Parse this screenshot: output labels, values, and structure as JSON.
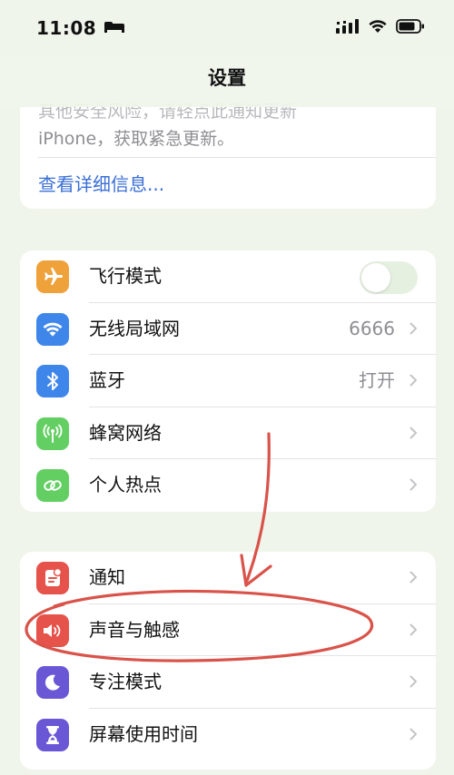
{
  "status_bar": {
    "time": "11:08"
  },
  "nav": {
    "title": "设置"
  },
  "notice": {
    "line1": "其他安全风险，请轻点此通知更新",
    "line2": "iPhone，获取紧急更新。",
    "link": "查看详细信息..."
  },
  "group1": [
    {
      "label": "飞行模式",
      "value": "",
      "icon": "airplane-icon",
      "color": "#f0a23a",
      "control": "toggle",
      "toggle_on": false
    },
    {
      "label": "无线局域网",
      "value": "6666",
      "icon": "wifi-icon",
      "color": "#3f86ea",
      "control": "chevron"
    },
    {
      "label": "蓝牙",
      "value": "打开",
      "icon": "bluetooth-icon",
      "color": "#3f86ea",
      "control": "chevron"
    },
    {
      "label": "蜂窝网络",
      "value": "",
      "icon": "cellular-antenna-icon",
      "color": "#63cf63",
      "control": "chevron"
    },
    {
      "label": "个人热点",
      "value": "",
      "icon": "hotspot-link-icon",
      "color": "#63cf63",
      "control": "chevron"
    }
  ],
  "group2": [
    {
      "label": "通知",
      "value": "",
      "icon": "notification-bell-icon",
      "color": "#e5534b",
      "control": "chevron"
    },
    {
      "label": "声音与触感",
      "value": "",
      "icon": "speaker-icon",
      "color": "#e5534b",
      "control": "chevron"
    },
    {
      "label": "专注模式",
      "value": "",
      "icon": "moon-icon",
      "color": "#6a57d6",
      "control": "chevron"
    },
    {
      "label": "屏幕使用时间",
      "value": "",
      "icon": "hourglass-icon",
      "color": "#6a57d6",
      "control": "chevron"
    }
  ],
  "annotation_color": "#d9534a"
}
